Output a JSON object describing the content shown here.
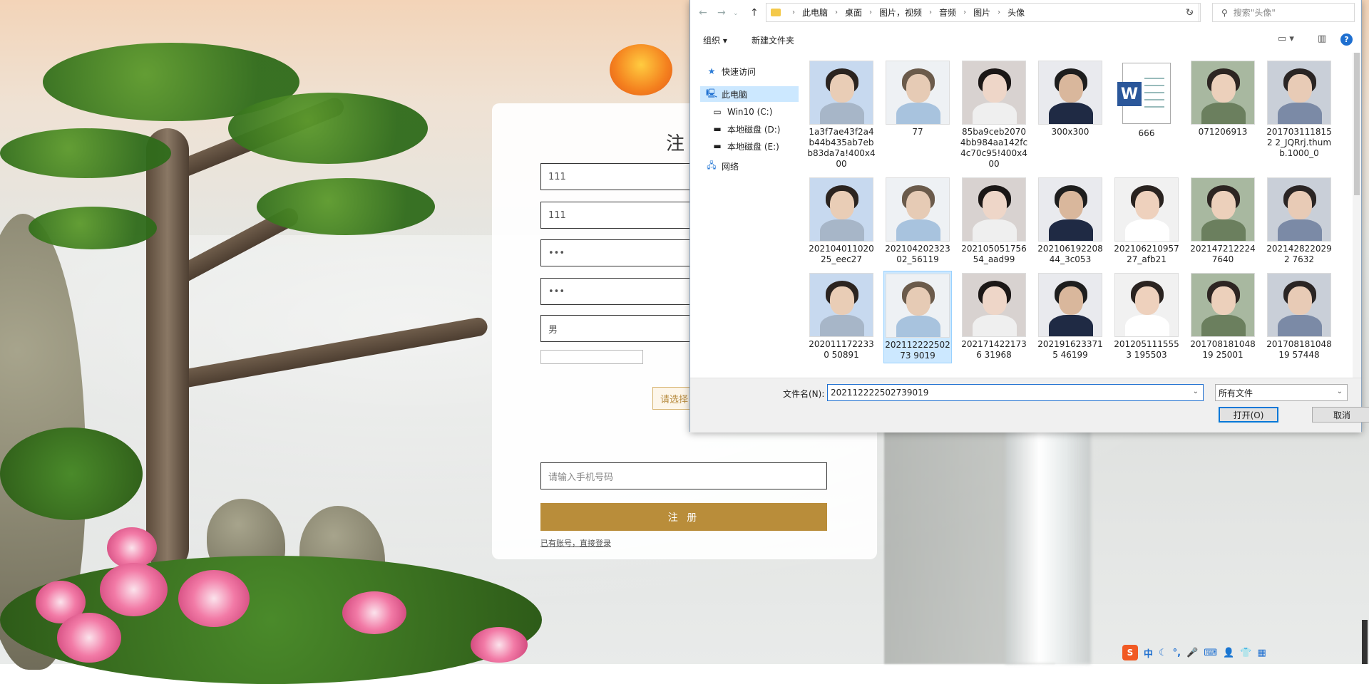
{
  "register": {
    "title": "注册",
    "fields": [
      "111",
      "111",
      "•••",
      "•••",
      "男"
    ],
    "upload_label": "请选择",
    "phone_placeholder": "请输入手机号码",
    "submit": "注 册",
    "login_link": "已有账号，直接登录"
  },
  "dialog": {
    "breadcrumbs": [
      "此电脑",
      "桌面",
      "图片，视频",
      "音频",
      "图片",
      "头像"
    ],
    "search_placeholder": "搜索\"头像\"",
    "toolbar": {
      "organize": "组织 ▾",
      "new_folder": "新建文件夹"
    },
    "nav": [
      "快速访问",
      "此电脑",
      "Win10 (C:)",
      "本地磁盘 (D:)",
      "本地磁盘 (E:)",
      "网络"
    ],
    "files": [
      {
        "name": "1a3f7ae43f2a4b44b435ab7ebb83da7a!400x400",
        "kind": "photo"
      },
      {
        "name": "77",
        "kind": "photo"
      },
      {
        "name": "85ba9ceb20704bb984aa142fc4c70c95!400x400",
        "kind": "photo"
      },
      {
        "name": "300x300",
        "kind": "photo"
      },
      {
        "name": "666",
        "kind": "word"
      },
      {
        "name": "071206913",
        "kind": "photo"
      },
      {
        "name": "2017031118152 2_JQRrj.thumb.1000_0",
        "kind": "photo"
      },
      {
        "name": "20210401102025_eec27",
        "kind": "photo"
      },
      {
        "name": "20210420232302_56119",
        "kind": "photo"
      },
      {
        "name": "20210505175654_aad99",
        "kind": "photo"
      },
      {
        "name": "20210619220844_3c053",
        "kind": "photo"
      },
      {
        "name": "20210621095727_afb21",
        "kind": "photo"
      },
      {
        "name": "2021472122247640",
        "kind": "photo"
      },
      {
        "name": "2021428220292 7632",
        "kind": "photo"
      },
      {
        "name": "2020111722330 50891",
        "kind": "photo"
      },
      {
        "name": "20211222250273 9019",
        "kind": "photo",
        "selected": true
      },
      {
        "name": "2021714221736 31968",
        "kind": "photo"
      },
      {
        "name": "2021916233715 46199",
        "kind": "photo"
      },
      {
        "name": "2012051115553 195503",
        "kind": "photo"
      },
      {
        "name": "20170818104819 25001",
        "kind": "photo"
      },
      {
        "name": "20170818104819 57448",
        "kind": "photo"
      }
    ],
    "filename_label": "文件名(N):",
    "filename_value": "202112222502739019",
    "filetype": "所有文件",
    "open": "打开(O)",
    "cancel": "取消"
  },
  "tray": [
    "中",
    "☾",
    "°,",
    "🎤",
    "⌨",
    "👤",
    "👕",
    "▦"
  ]
}
